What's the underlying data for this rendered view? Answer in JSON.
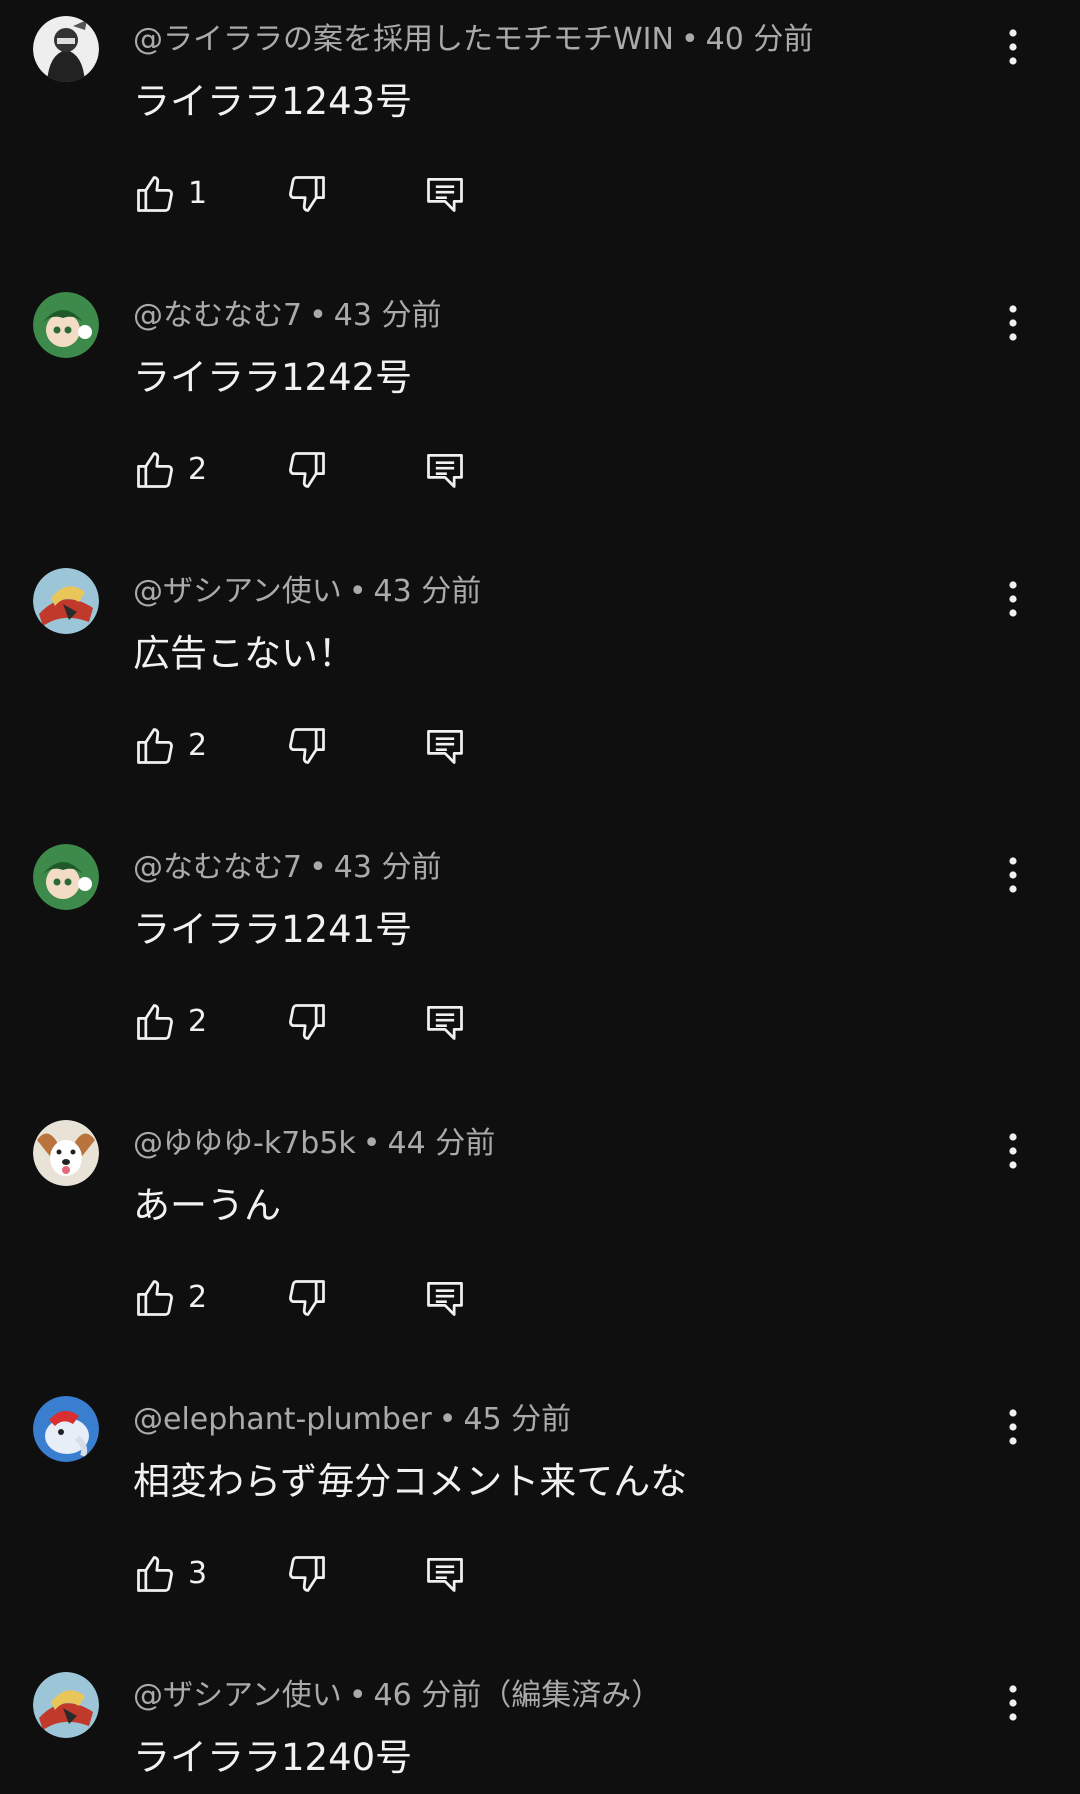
{
  "comments": [
    {
      "author": "@ライララの案を採用したモチモチWIN",
      "time": "40 分前",
      "text": "ライララ1243号",
      "likes": "1",
      "avatar_color": "#e8e8e8"
    },
    {
      "author": "@なむなむ7",
      "time": "43 分前",
      "text": "ライララ1242号",
      "likes": "2",
      "avatar_color": "#3d8a4a"
    },
    {
      "author": "@ザシアン使い",
      "time": "43 分前",
      "text": "広告こない！",
      "likes": "2",
      "avatar_color": "#9cc6d8"
    },
    {
      "author": "@なむなむ7",
      "time": "43 分前",
      "text": "ライララ1241号",
      "likes": "2",
      "avatar_color": "#3d8a4a"
    },
    {
      "author": "@ゆゆゆ-k7b5k",
      "time": "44 分前",
      "text": "あーうん",
      "likes": "2",
      "avatar_color": "#c8935a"
    },
    {
      "author": "@elephant-plumber",
      "time": "45 分前",
      "text": "相変わらず毎分コメント来てんな",
      "likes": "3",
      "avatar_color": "#3a7ed0"
    },
    {
      "author": "@ザシアン使い",
      "time": "46 分前（編集済み）",
      "text": "ライララ1240号",
      "likes": "",
      "avatar_color": "#9cc6d8"
    }
  ],
  "separator": "•",
  "icons": {
    "avatar": "avatar-icon",
    "like": "thumbs-up-icon",
    "dislike": "thumbs-down-icon",
    "reply": "reply-comment-icon",
    "more": "more-vertical-icon"
  },
  "colors": {
    "background": "#0f0f0f",
    "text_primary": "#f1f1f1",
    "text_secondary": "#aaaaaa"
  }
}
